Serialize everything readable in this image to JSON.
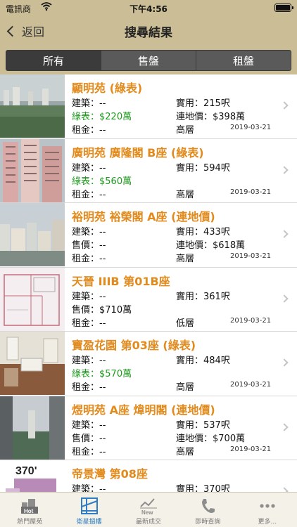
{
  "statusbar": {
    "carrier": "電訊商",
    "time": "下午4:56"
  },
  "navbar": {
    "back_label": "返回",
    "title": "搜尋結果"
  },
  "segments": [
    {
      "label": "所有",
      "active": true
    },
    {
      "label": "售盤",
      "active": false
    },
    {
      "label": "租盤",
      "active": false
    }
  ],
  "listings": [
    {
      "title": "顯明苑 (綠表)",
      "area_label": "建築：--",
      "usable_label": "實用：215呎",
      "price_label": "綠表：$220萬",
      "price_green": true,
      "price2_label": "連地價：$398萬",
      "rent_label": "租金：--",
      "floor": "高層",
      "date": "2019-03-21"
    },
    {
      "title": "廣明苑 廣隆閣 B座 (綠表)",
      "area_label": "建築：--",
      "usable_label": "實用：594呎",
      "price_label": "綠表：$560萬",
      "price_green": true,
      "price2_label": "",
      "rent_label": "租金：--",
      "floor": "高層",
      "date": "2019-03-21"
    },
    {
      "title": "裕明苑 裕榮閣 A座 (連地價)",
      "area_label": "建築：--",
      "usable_label": "實用：433呎",
      "price_label": "售價：--",
      "price_green": false,
      "price2_label": "連地價：$618萬",
      "rent_label": "租金：--",
      "floor": "高層",
      "date": "2019-03-21"
    },
    {
      "title": "天晉 IIIB 第01B座",
      "area_label": "建築：--",
      "usable_label": "實用：361呎",
      "price_label": "售價：$710萬",
      "price_green": false,
      "price2_label": "",
      "rent_label": "租金：--",
      "floor": "低層",
      "date": "2019-03-21"
    },
    {
      "title": "寶盈花園 第03座 (綠表)",
      "area_label": "建築：--",
      "usable_label": "實用：484呎",
      "price_label": "綠表：$570萬",
      "price_green": true,
      "price2_label": "",
      "rent_label": "租金：--",
      "floor": "高層",
      "date": "2019-03-21"
    },
    {
      "title": "煜明苑 A座 煒明閣 (連地價)",
      "area_label": "建築：--",
      "usable_label": "實用：537呎",
      "price_label": "售價：--",
      "price_green": false,
      "price2_label": "連地價：$700萬",
      "rent_label": "租金：--",
      "floor": "高層",
      "date": "2019-03-21"
    },
    {
      "title": "帝景灣 第08座",
      "area_label": "建築：--",
      "usable_label": "實用：370呎",
      "price_label": "",
      "price_green": false,
      "price2_label": "",
      "rent_label": "",
      "floor": "",
      "date": "",
      "thumb_text": "370'"
    }
  ],
  "tabs": [
    {
      "label": "熱門屋苑",
      "icon": "hot-building-icon",
      "active": false,
      "badge": "Hot"
    },
    {
      "label": "衛星搵樓",
      "icon": "satellite-map-icon",
      "active": true
    },
    {
      "label": "最新成交",
      "icon": "new-trend-icon",
      "active": false,
      "badge": "New"
    },
    {
      "label": "即時查詢",
      "icon": "phone-icon",
      "active": false
    },
    {
      "label": "更多...",
      "icon": "more-icon",
      "active": false
    }
  ]
}
